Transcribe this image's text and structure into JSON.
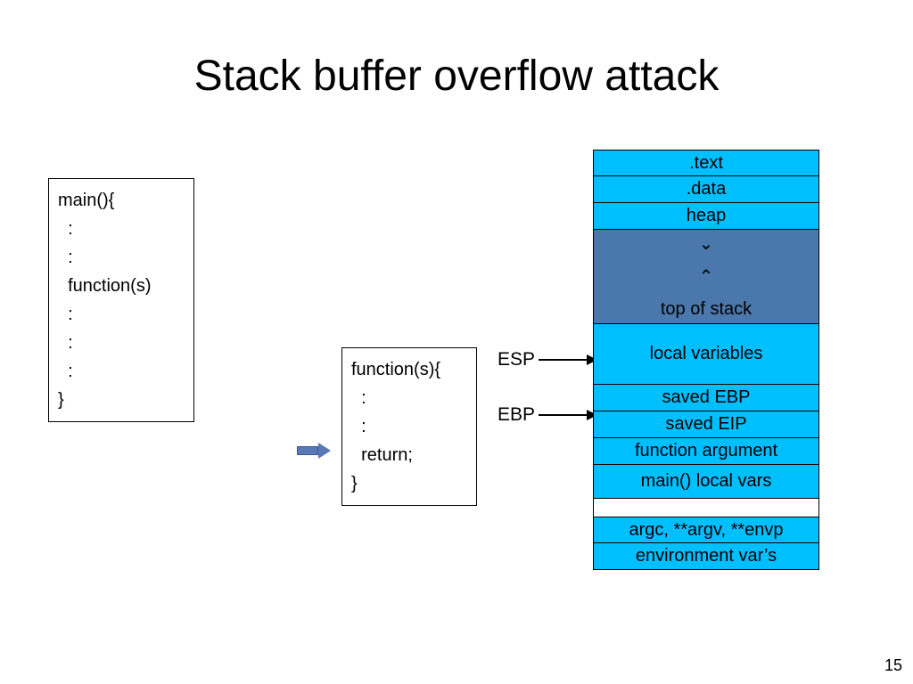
{
  "title": "Stack buffer overflow attack",
  "page_number": "15",
  "main_code": {
    "l0": "main(){",
    "l1": "  :",
    "l2": "  :",
    "l3": "  function(s)",
    "l4": "  :",
    "l5": "  :",
    "l6": "  :",
    "l7": "}"
  },
  "func_code": {
    "l0": "function(s){",
    "l1": "  :",
    "l2": "  :",
    "l3": "  return;",
    "l4": "}"
  },
  "pointers": {
    "esp": "ESP",
    "ebp": "EBP"
  },
  "memory": {
    "text": ".text",
    "data": ".data",
    "heap": "heap",
    "grow_down": "⌄",
    "grow_up": "⌃",
    "top_of_stack": "top of stack",
    "local_vars": "local variables",
    "saved_ebp": "saved EBP",
    "saved_eip": "saved EIP",
    "func_arg": "function argument",
    "main_locals": "main() local vars",
    "argc": "argc, **argv, **envp",
    "env": "environment var’s"
  }
}
